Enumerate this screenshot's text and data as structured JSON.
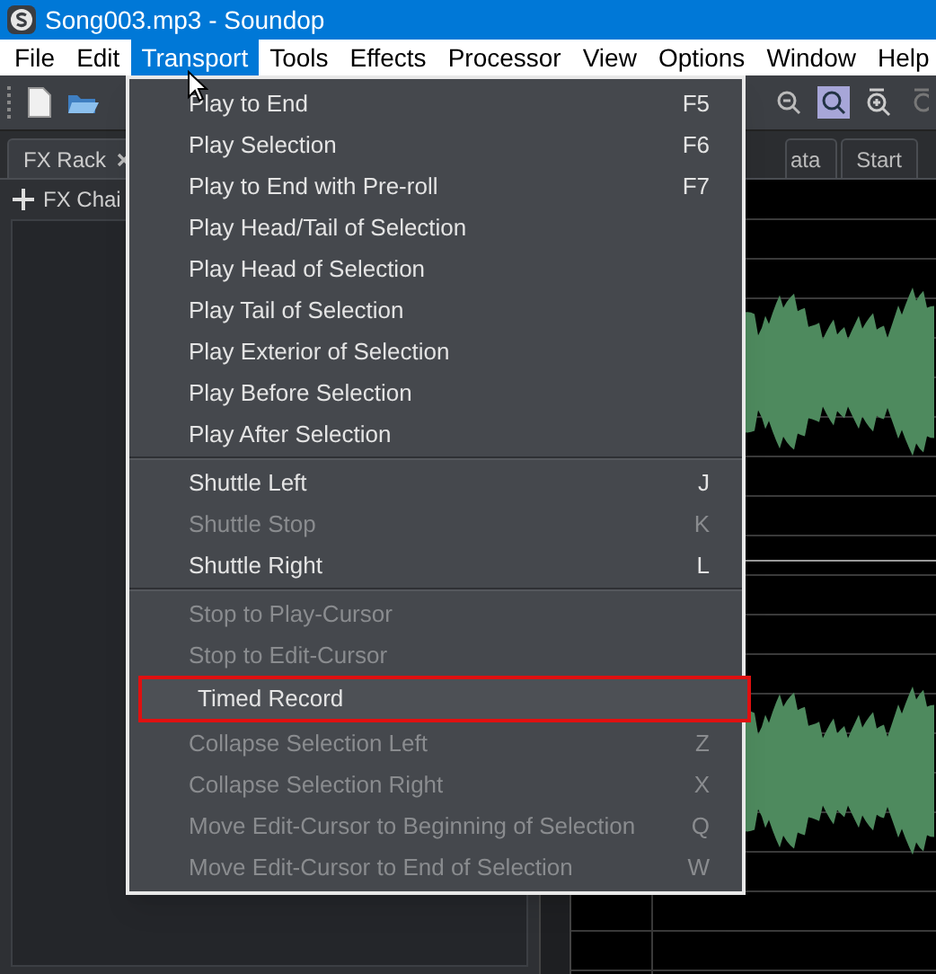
{
  "window": {
    "title": "Song003.mp3 - Soundop"
  },
  "menu_bar": [
    {
      "label": "File",
      "selected": false
    },
    {
      "label": "Edit",
      "selected": false
    },
    {
      "label": "Transport",
      "selected": true
    },
    {
      "label": "Tools",
      "selected": false
    },
    {
      "label": "Effects",
      "selected": false
    },
    {
      "label": "Processor",
      "selected": false
    },
    {
      "label": "View",
      "selected": false
    },
    {
      "label": "Options",
      "selected": false
    },
    {
      "label": "Window",
      "selected": false
    },
    {
      "label": "Help",
      "selected": false
    }
  ],
  "panel_tabs": [
    {
      "label": "FX Rack",
      "selected": true
    },
    {
      "label": "ata",
      "selected": false
    },
    {
      "label": "Start",
      "selected": false
    }
  ],
  "fx_chain": {
    "label": "FX Chai"
  },
  "transport_menu": [
    [
      {
        "label": "Play to End",
        "shortcut": "F5",
        "disabled": false,
        "highlighted": false
      },
      {
        "label": "Play Selection",
        "shortcut": "F6",
        "disabled": false,
        "highlighted": false
      },
      {
        "label": "Play to End with Pre-roll",
        "shortcut": "F7",
        "disabled": false,
        "highlighted": false
      },
      {
        "label": "Play Head/Tail of Selection",
        "disabled": false,
        "highlighted": false
      },
      {
        "label": "Play Head of Selection",
        "disabled": false,
        "highlighted": false
      },
      {
        "label": "Play Tail of Selection",
        "disabled": false,
        "highlighted": false
      },
      {
        "label": "Play Exterior of Selection",
        "disabled": false,
        "highlighted": false
      },
      {
        "label": "Play Before Selection",
        "disabled": false,
        "highlighted": false
      },
      {
        "label": "Play After Selection",
        "disabled": false,
        "highlighted": false
      }
    ],
    [
      {
        "label": "Shuttle Left",
        "shortcut": "J",
        "disabled": false,
        "highlighted": false
      },
      {
        "label": "Shuttle Stop",
        "shortcut": "K",
        "disabled": true,
        "highlighted": false
      },
      {
        "label": "Shuttle Right",
        "shortcut": "L",
        "disabled": false,
        "highlighted": false
      }
    ],
    [
      {
        "label": "Stop to Play-Cursor",
        "disabled": true,
        "highlighted": false
      },
      {
        "label": "Stop to Edit-Cursor",
        "disabled": true,
        "highlighted": false
      },
      {
        "label": "Timed Record",
        "disabled": false,
        "highlighted": true
      },
      {
        "label": "Collapse Selection Left",
        "shortcut": "Z",
        "disabled": true,
        "highlighted": false
      },
      {
        "label": "Collapse Selection Right",
        "shortcut": "X",
        "disabled": true,
        "highlighted": false
      },
      {
        "label": "Move Edit-Cursor to Beginning of Selection",
        "shortcut": "Q",
        "disabled": true,
        "highlighted": false
      },
      {
        "label": "Move Edit-Cursor to End of Selection",
        "shortcut": "W",
        "disabled": true,
        "highlighted": false
      }
    ]
  ]
}
